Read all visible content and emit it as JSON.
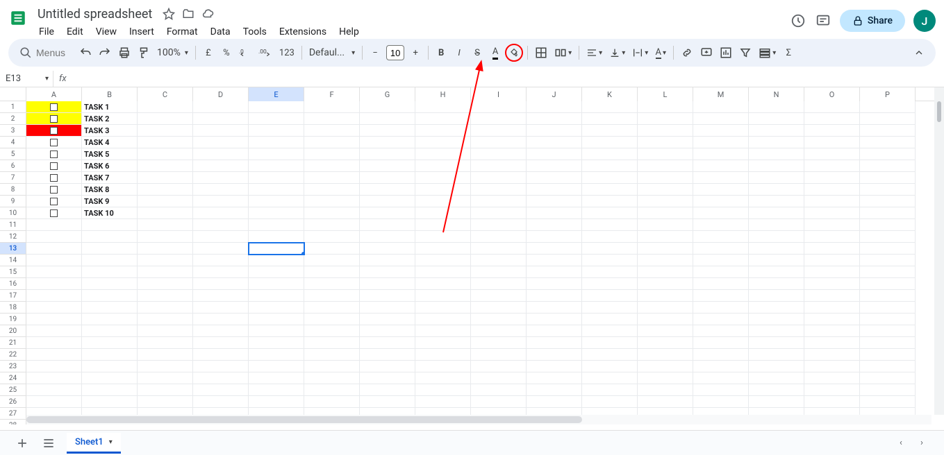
{
  "header": {
    "doc_title": "Untitled spreadsheet",
    "menus": [
      "File",
      "Edit",
      "View",
      "Insert",
      "Format",
      "Data",
      "Tools",
      "Extensions",
      "Help"
    ],
    "share_label": "Share",
    "avatar_letter": "J"
  },
  "toolbar": {
    "search_placeholder": "Menus",
    "zoom": "100%",
    "currency": "£",
    "percent": "%",
    "decrease_decimal": ".0",
    "increase_decimal": ".00",
    "number_format": "123",
    "font_name": "Defaul...",
    "font_size": "10"
  },
  "name_box": "E13",
  "formula": "",
  "columns": [
    "A",
    "B",
    "C",
    "D",
    "E",
    "F",
    "G",
    "H",
    "I",
    "J",
    "K",
    "L",
    "M",
    "N",
    "O",
    "P"
  ],
  "active_col_index": 4,
  "row_count": 29,
  "active_row": 13,
  "cells": {
    "task_col_A": [
      {
        "bg": "yellow-bg",
        "checkbox": true
      },
      {
        "bg": "yellow-bg",
        "checkbox": true
      },
      {
        "bg": "red-bg",
        "checkbox": true
      },
      {
        "bg": "",
        "checkbox": true
      },
      {
        "bg": "",
        "checkbox": true
      },
      {
        "bg": "",
        "checkbox": true
      },
      {
        "bg": "",
        "checkbox": true
      },
      {
        "bg": "",
        "checkbox": true
      },
      {
        "bg": "",
        "checkbox": true
      },
      {
        "bg": "",
        "checkbox": true
      }
    ],
    "task_col_B": [
      "TASK 1",
      "TASK 2",
      "TASK 3",
      "TASK 4",
      "TASK 5",
      "TASK 6",
      "TASK 7",
      "TASK 8",
      "TASK 9",
      "TASK 10"
    ]
  },
  "sheet_bar": {
    "tab_name": "Sheet1"
  },
  "colors": {
    "accent": "#1a73e8",
    "share_bg": "#c2e7ff",
    "avatar_bg": "#00897b",
    "yellow": "#ffff00",
    "red": "#ff0000",
    "annotation": "#ff0000"
  }
}
